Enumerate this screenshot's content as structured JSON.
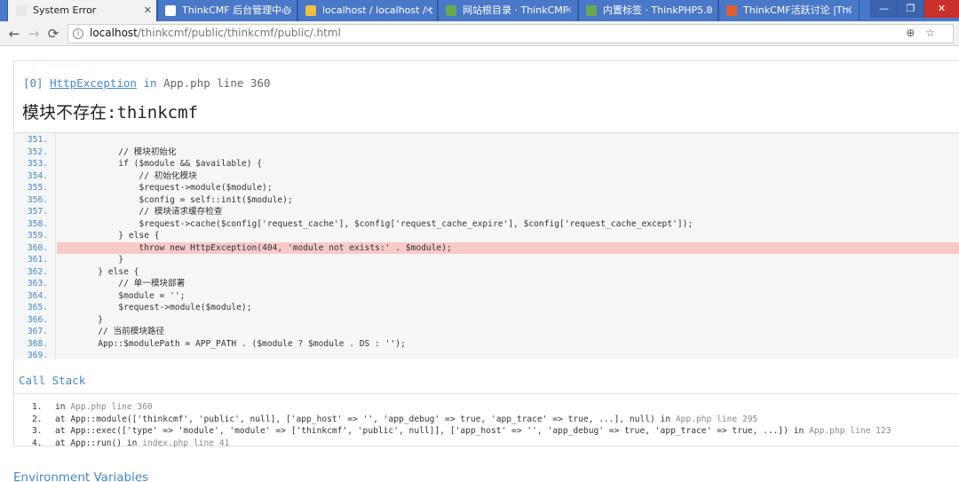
{
  "browser": {
    "tabs": [
      {
        "title": "System Error",
        "active": true,
        "favicon_color": "#e8e8e8"
      },
      {
        "title": "ThinkCMF 后台管理中心",
        "active": false,
        "favicon_color": "#ffffff"
      },
      {
        "title": "localhost / localhost / t",
        "active": false,
        "favicon_color": "#f0c040"
      },
      {
        "title": "网站根目录 · ThinkCMF",
        "active": false,
        "favicon_color": "#6aa84f"
      },
      {
        "title": "内置标签 · ThinkPHP5.0",
        "active": false,
        "favicon_color": "#6aa84f"
      },
      {
        "title": "ThinkCMF活跃讨论 |Thi",
        "active": false,
        "favicon_color": "#e06030"
      }
    ],
    "window_controls": [
      "—",
      "❐",
      "✕"
    ],
    "nav": {
      "back": "←",
      "forward": "→",
      "reload": "⟳"
    },
    "address": {
      "host": "localhost",
      "path": "/thinkcmf/public/thinkcmf/public/.html",
      "info_icon": "i",
      "zoom_icon": "⊕",
      "star_icon": "☆"
    }
  },
  "exception": {
    "index": "[0]",
    "class_name": "HttpException",
    "in_word": "in",
    "location": "App.php line 360",
    "message": "模块不存在:thinkcmf"
  },
  "source": {
    "highlight_line": 360,
    "lines": [
      {
        "n": "351.",
        "code": ""
      },
      {
        "n": "352.",
        "code": "            // 模块初始化"
      },
      {
        "n": "353.",
        "code": "            if ($module && $available) {"
      },
      {
        "n": "354.",
        "code": "                // 初始化模块"
      },
      {
        "n": "355.",
        "code": "                $request->module($module);"
      },
      {
        "n": "356.",
        "code": "                $config = self::init($module);"
      },
      {
        "n": "357.",
        "code": "                // 模块请求缓存检查"
      },
      {
        "n": "358.",
        "code": "                $request->cache($config['request_cache'], $config['request_cache_expire'], $config['request_cache_except']);"
      },
      {
        "n": "359.",
        "code": "            } else {"
      },
      {
        "n": "360.",
        "code": "                throw new HttpException(404, 'module not exists:' . $module);"
      },
      {
        "n": "361.",
        "code": "            }"
      },
      {
        "n": "362.",
        "code": "        } else {"
      },
      {
        "n": "363.",
        "code": "            // 单一模块部署"
      },
      {
        "n": "364.",
        "code": "            $module = '';"
      },
      {
        "n": "365.",
        "code": "            $request->module($module);"
      },
      {
        "n": "366.",
        "code": "        }"
      },
      {
        "n": "367.",
        "code": "        // 当前模块路径"
      },
      {
        "n": "368.",
        "code": "        App::$modulePath = APP_PATH . ($module ? $module . DS : '');"
      },
      {
        "n": "369.",
        "code": ""
      }
    ]
  },
  "call_stack": {
    "title": "Call Stack",
    "frames": [
      {
        "n": "1.",
        "call": "in ",
        "meta": "App.php line 360"
      },
      {
        "n": "2.",
        "call": "at App::module(['thinkcmf', 'public', null], ['app_host' => '', 'app_debug' => true, 'app_trace' => true, ...], null) in ",
        "meta": "App.php line 295"
      },
      {
        "n": "3.",
        "call": "at App::exec(['type' => 'module', 'module' => ['thinkcmf', 'public', null]], ['app_host' => '', 'app_debug' => true, 'app_trace' => true, ...]) in ",
        "meta": "App.php line 123"
      },
      {
        "n": "4.",
        "call": "at App::run() in ",
        "meta": "index.php line 41"
      }
    ]
  },
  "environment": {
    "title": "Environment Variables"
  }
}
